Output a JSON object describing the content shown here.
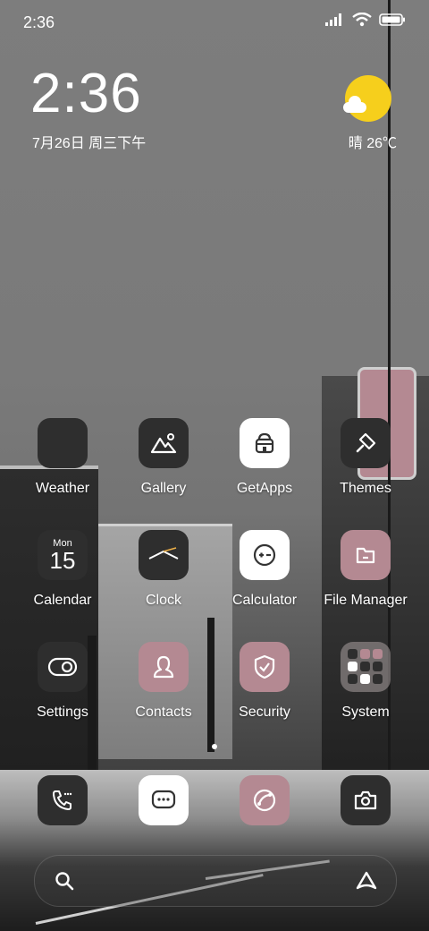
{
  "status": {
    "time": "2:36"
  },
  "clock_widget": {
    "time": "2:36",
    "date": "7月26日 周三下午"
  },
  "weather_widget": {
    "text": "晴 26℃",
    "icon": "sun-cloud-icon",
    "sun_color": "#f6cf1c"
  },
  "apps": {
    "weather": "Weather",
    "gallery": "Gallery",
    "getapps": "GetApps",
    "themes": "Themes",
    "calendar": "Calendar",
    "calendar_month": "Mon",
    "calendar_day": "15",
    "clock": "Clock",
    "calculator": "Calculator",
    "file_manager": "File Manager",
    "settings": "Settings",
    "contacts": "Contacts",
    "security": "Security",
    "system": "System"
  },
  "dock": {
    "items": [
      "phone-icon",
      "messages-icon",
      "browser-icon",
      "camera-icon"
    ]
  },
  "search": {
    "left_icon": "search-icon",
    "right_icon": "assistant-icon"
  },
  "colors": {
    "pink": "#b48992",
    "dark": "#2e2e2e",
    "white": "#ffffff"
  },
  "pages": {
    "count": 2,
    "active": 1
  }
}
